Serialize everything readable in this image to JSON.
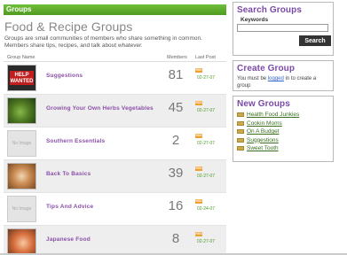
{
  "header": {
    "title": "Groups"
  },
  "main": {
    "title": "Food & Recipe Groups",
    "description": "Groups are small communities of members who share something in common. Members share tips, recipes, and talk about whatever.",
    "columns": {
      "name": "Group Name",
      "members": "Members",
      "last_post": "Last Post"
    }
  },
  "groups": [
    {
      "name": "Suggestions",
      "members": "81",
      "rss": "RSS",
      "date": "02-27-07",
      "thumb": "help-wanted",
      "thumb_text": "HELP WANTED"
    },
    {
      "name": "Growing Your Own Herbs Vegetables",
      "members": "45",
      "rss": "RSS",
      "date": "02-27-07",
      "thumb": "herbs"
    },
    {
      "name": "Southern Essentials",
      "members": "2",
      "rss": "RSS",
      "date": "02-27-07",
      "thumb": "no-image",
      "thumb_text": "No Image"
    },
    {
      "name": "Back To Basics",
      "members": "39",
      "rss": "RSS",
      "date": "02-27-07",
      "thumb": "basics"
    },
    {
      "name": "Tips And Advice",
      "members": "16",
      "rss": "RSS",
      "date": "02-24-07",
      "thumb": "no-image",
      "thumb_text": "No Image"
    },
    {
      "name": "Japanese Food",
      "members": "8",
      "rss": "RSS",
      "date": "02-27-07",
      "thumb": "japanese"
    }
  ],
  "search": {
    "title": "Search Groups",
    "keywords_label": "Keywords",
    "keywords_value": "",
    "button_label": "Search"
  },
  "create": {
    "title": "Create Group",
    "text_before": "You must be ",
    "link_label": "logged",
    "text_after": " in to create a group"
  },
  "new_groups": {
    "title": "New Groups",
    "items": [
      "Health Food Junkies",
      "Cookin Moms",
      "On A Budget",
      "Suggestions",
      "Sweet Tooth"
    ]
  },
  "colors": {
    "header_green": "#5aa82a",
    "group_link": "#8a4fa8",
    "date_green": "#4a9a2a",
    "sidebar_title": "#7a4aa8"
  }
}
